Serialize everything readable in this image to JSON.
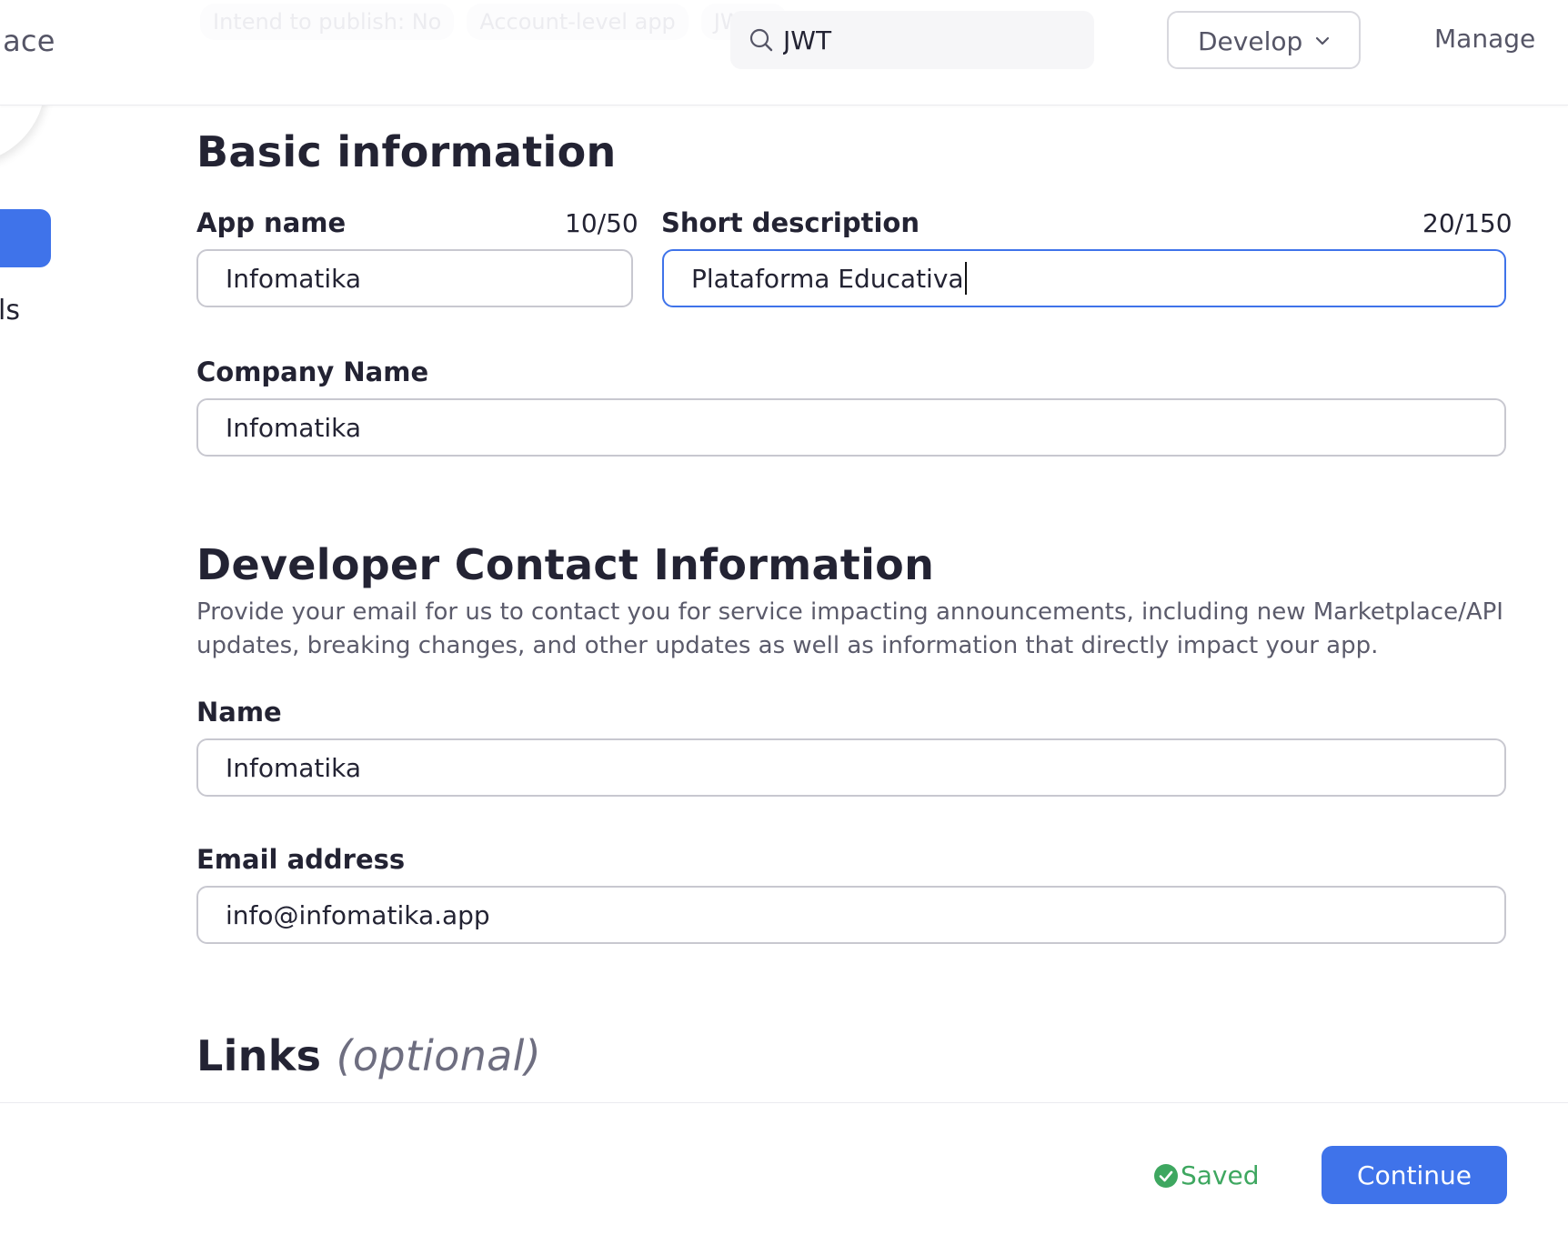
{
  "header": {
    "brand_partial": "lace",
    "faded_tags": [
      "Intend to publish: No",
      "Account-level app",
      "JWT c"
    ],
    "search": {
      "value": "JWT"
    },
    "develop_label": "Develop",
    "manage_label": "Manage"
  },
  "sidebar": {
    "partial_label": "ls"
  },
  "basic_info": {
    "heading": "Basic information",
    "app_name": {
      "label": "App name",
      "counter": "10/50",
      "value": "Infomatika"
    },
    "short_description": {
      "label": "Short description",
      "counter": "20/150",
      "value": "Plataforma Educativa"
    },
    "company_name": {
      "label": "Company Name",
      "value": "Infomatika"
    }
  },
  "developer_contact": {
    "heading": "Developer Contact Information",
    "description": "Provide your email for us to contact you for service impacting announcements, including new Marketplace/API updates, breaking changes, and other updates as well as information that directly impact your app.",
    "name": {
      "label": "Name",
      "value": "Infomatika"
    },
    "email": {
      "label": "Email address",
      "value": "info@infomatika.app"
    }
  },
  "links": {
    "heading": "Links",
    "optional": "(optional)"
  },
  "footer": {
    "saved_label": "Saved",
    "continue_label": "Continue"
  },
  "colors": {
    "accent": "#3f73ea",
    "saved_green": "#3ea760",
    "text": "#232333"
  }
}
